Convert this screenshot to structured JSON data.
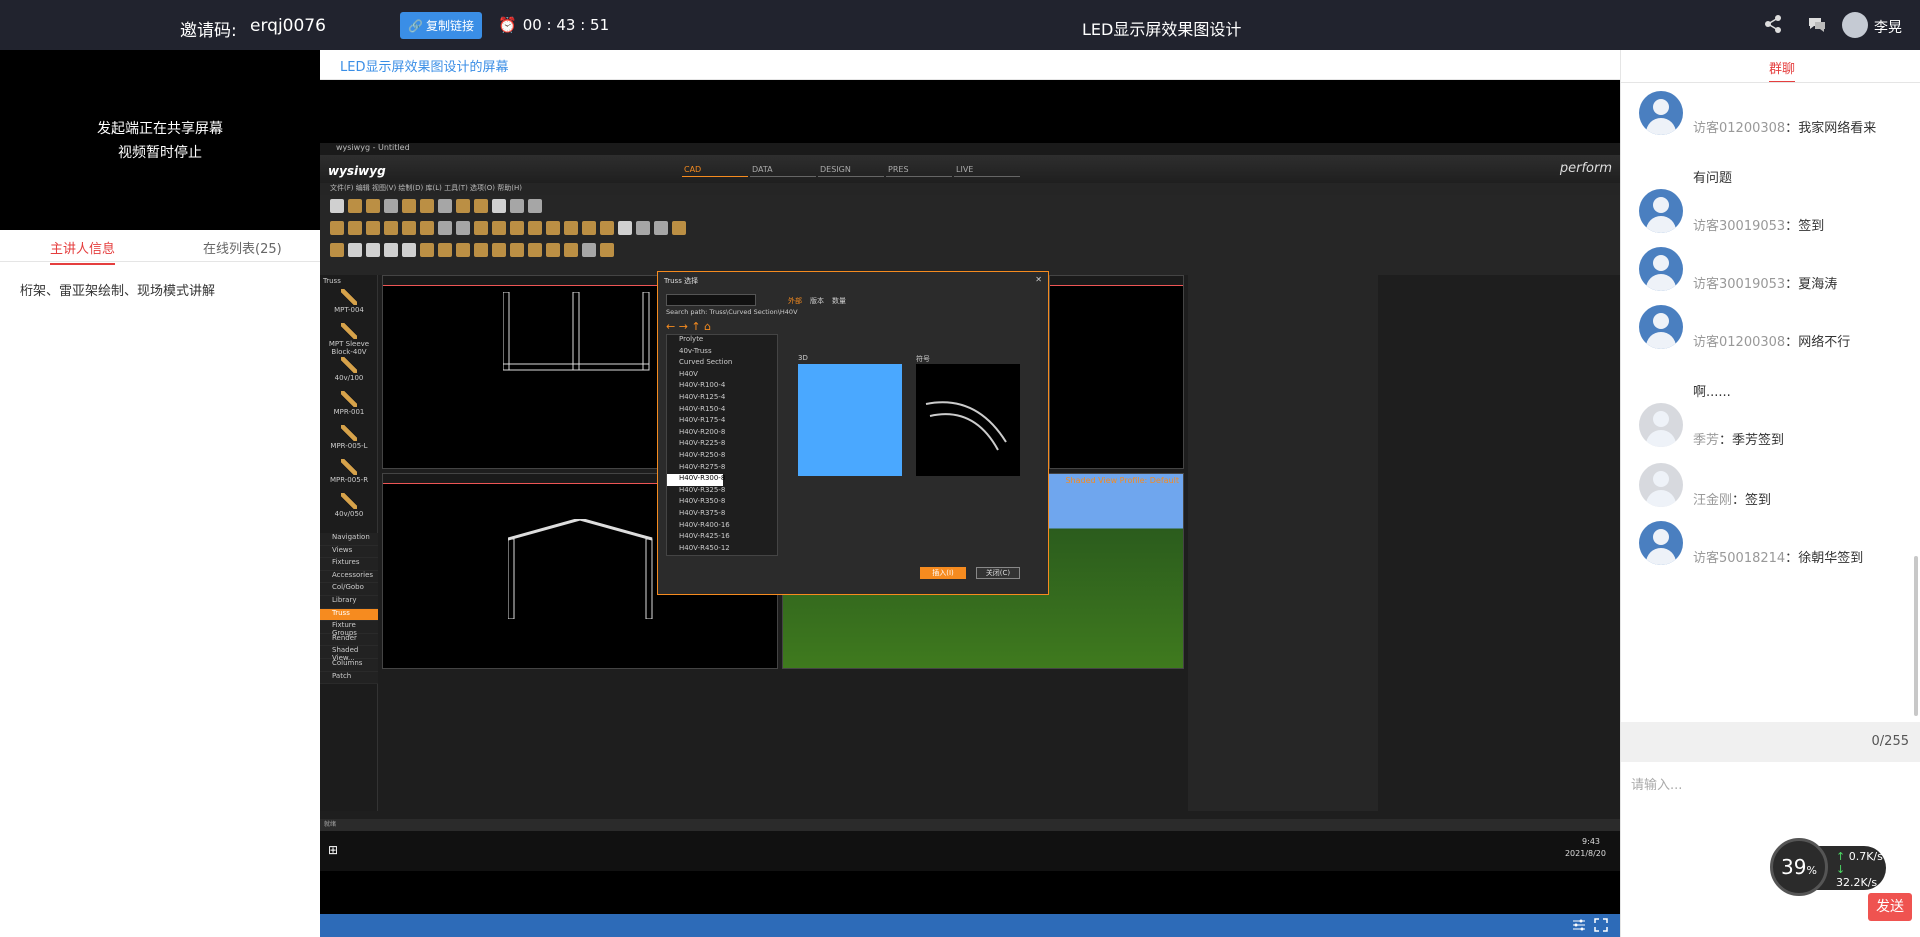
{
  "topbar": {
    "invite_label": "邀请码:",
    "invite_code": "erqj0076",
    "copy_link_label": "复制链接",
    "timer": "00 : 43 : 51",
    "meeting_title": "LED显示屏效果图设计",
    "user_name": "李晃"
  },
  "left": {
    "video_msg_line1": "发起端正在共享屏幕",
    "video_msg_line2": "视频暂时停止",
    "tab_presenter": "主讲人信息",
    "tab_online": "在线列表(25)",
    "presenter_desc": "桁架、雷亚架绘制、现场模式讲解"
  },
  "center": {
    "screen_title": "LED显示屏效果图设计的屏幕"
  },
  "app": {
    "window_title": "wysiwyg - Untitled",
    "logo": "wysiwyg",
    "modes": [
      "CAD",
      "DATA",
      "DESIGN",
      "PRES",
      "LIVE"
    ],
    "perform": "perform",
    "menu": "文件(F)   编辑   视图(V)   绘制(D)   库(L)   工具(T)   选项(O)   帮助(H)",
    "panel_title": "Truss",
    "truss_items": [
      "MPT-004",
      "MPT Sleeve Block-40V",
      "40v/100",
      "MPR-001",
      "MPR-005-L",
      "MPR-005-R",
      "40v/050"
    ],
    "nav_items": [
      "Navigation",
      "Views",
      "Fixtures",
      "Accessories",
      "Col/Gobo",
      "Library",
      "Truss",
      "Fixture Groups",
      "Render",
      "Shaded View...",
      "Columns",
      "Patch"
    ],
    "nav_active": "Truss",
    "dialog_title": "Truss 选择",
    "dialog_search_path": "Search path: Truss\\Curved Section\\H40V",
    "dialog_tree": [
      "Prolyte",
      "40v-Truss",
      "Curved Section",
      "H40V",
      "H40V-R100-4",
      "H40V-R125-4",
      "H40V-R150-4",
      "H40V-R175-4",
      "H40V-R200-8",
      "H40V-R225-8",
      "H40V-R250-8",
      "H40V-R275-8",
      "H40V-R300-8",
      "H40V-R325-8",
      "H40V-R350-8",
      "H40V-R375-8",
      "H40V-R400-16",
      "H40V-R425-16",
      "H40V-R450-12"
    ],
    "dialog_selected": "H40V-R300-8",
    "dialog_tabs": [
      "外部",
      "版本",
      "数量"
    ],
    "preview_3d_label": "3D",
    "preview_sym_label": "符号",
    "insert_label": "插入(I)",
    "close_label": "关闭(C)",
    "shaded_view_label": "Shaded View Profile: Default",
    "statusbar": "就绪",
    "clock_time": "9:43",
    "clock_date": "2021/8/20"
  },
  "chat": {
    "tab_label": "群聊",
    "messages": [
      {
        "name": "访客01200308",
        "text": "我家网络看来有问题",
        "line1": "我家网络看来",
        "line2": "有问题",
        "grey": false
      },
      {
        "name": "访客30019053",
        "text": "签到",
        "line1": "签到",
        "line2": "",
        "grey": false
      },
      {
        "name": "访客30019053",
        "text": "夏海涛",
        "line1": "夏海涛",
        "line2": "",
        "grey": false
      },
      {
        "name": "访客01200308",
        "text": "网络不行啊......",
        "line1": "网络不行",
        "line2": "啊......",
        "grey": false
      },
      {
        "name": "季芳",
        "text": "季芳签到",
        "line1": "季芳签到",
        "line2": "",
        "grey": true
      },
      {
        "name": "汪金刚",
        "text": "签到",
        "line1": "签到",
        "line2": "",
        "grey": true
      },
      {
        "name": "访客50018214",
        "text": "徐朝华签到",
        "line1": "徐朝华签到",
        "line2": "",
        "grey": false
      }
    ],
    "char_count": "0/255",
    "input_placeholder": "请输入...",
    "send_label": "发送"
  },
  "network": {
    "percent": "39",
    "percent_unit": "%",
    "up": "0.7K/s",
    "down": "32.2K/s"
  }
}
